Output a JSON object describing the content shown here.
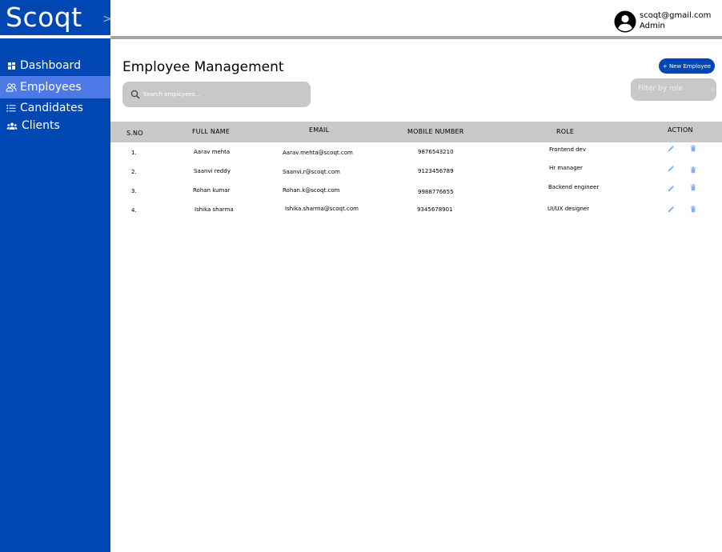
{
  "app": {
    "brand": "Scoqt",
    "brand_chevron": ">"
  },
  "sidebar": {
    "items": [
      {
        "label": "Dashboard",
        "icon": "grid-icon",
        "active": false
      },
      {
        "label": "Employees",
        "icon": "users-icon",
        "active": true
      },
      {
        "label": "Candidates",
        "icon": "list-icon",
        "active": false
      },
      {
        "label": "Clients",
        "icon": "group-icon",
        "active": false
      }
    ]
  },
  "user": {
    "email": "scoqt@gmail.com",
    "role": "Admin",
    "avatar_icon": "user-avatar-icon"
  },
  "main": {
    "title": "Employee Management",
    "new_button": "+ New Employee",
    "search_placeholder": "Search employees...",
    "filter_label": "Filter by role",
    "filter_chevron": ">"
  },
  "table": {
    "columns": [
      "S.NO",
      "FULL NAME",
      "EMAIL",
      "MOBILE NUMBER",
      "ROLE",
      "ACTION"
    ],
    "rows": [
      {
        "sno": "1.",
        "name": "Aarav mehta",
        "email": "Aarav.mehta@scoqt.com",
        "mobile": "9876543210",
        "role": "Frontend dev"
      },
      {
        "sno": "2.",
        "name": "Saanvi reddy",
        "email": "Saanvi.r@scoqt.com",
        "mobile": "9123456789",
        "role": "Hr manager"
      },
      {
        "sno": "3.",
        "name": "Rohan kumar",
        "email": "Rohan.k@scoqt.com",
        "mobile": "9988776655",
        "role": "Backend engineer"
      },
      {
        "sno": "4.",
        "name": "Ishika sharma",
        "email": "Ishika.sharma@scoqt.com",
        "mobile": "9345678901",
        "role": "UI/UX designer"
      }
    ]
  },
  "colors": {
    "brand_blue": "#0047b3",
    "active_nav": "#4d7ae6",
    "gray": "#c8c8c8",
    "action_icon": "#7fb0f0"
  }
}
